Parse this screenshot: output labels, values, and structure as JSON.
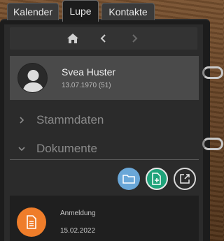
{
  "tabs": [
    {
      "label": "Kalender",
      "active": false
    },
    {
      "label": "Lupe",
      "active": true
    },
    {
      "label": "Kontakte",
      "active": false
    }
  ],
  "nav": {
    "home_icon": "home-icon",
    "back_icon": "chevron-left-icon",
    "forward_icon": "chevron-right-icon"
  },
  "person": {
    "name": "Svea Huster",
    "birth": "13.07.1970 (51)",
    "avatar_icon": "user-silhouette-icon"
  },
  "sections": [
    {
      "label": "Stammdaten",
      "expanded": false
    },
    {
      "label": "Dokumente",
      "expanded": true
    }
  ],
  "actions": [
    {
      "icon": "folder-icon",
      "color": "#6aa7d8"
    },
    {
      "icon": "add-document-icon",
      "color": "#1fa37a"
    },
    {
      "icon": "export-icon",
      "color": "#2b2b2b"
    }
  ],
  "documents": [
    {
      "title": "Anmeldung",
      "date": "15.02.2022",
      "icon": "document-icon",
      "color": "#ef7d2a"
    }
  ]
}
